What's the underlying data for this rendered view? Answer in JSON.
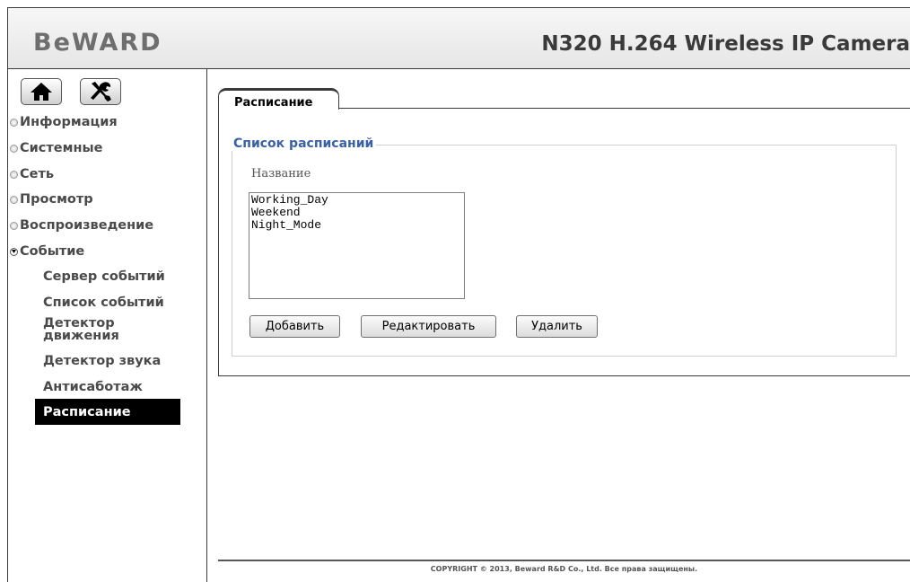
{
  "header": {
    "logo": "BeWARD",
    "title": "N320 H.264 Wireless IP Camera"
  },
  "sidebar": {
    "home_icon": "home-icon",
    "settings_icon": "tools-icon",
    "items": [
      {
        "label": "Информация",
        "state": "collapsed"
      },
      {
        "label": "Системные",
        "state": "collapsed"
      },
      {
        "label": "Сеть",
        "state": "collapsed"
      },
      {
        "label": "Просмотр",
        "state": "collapsed"
      },
      {
        "label": "Воспроизведение",
        "state": "collapsed"
      },
      {
        "label": "Событие",
        "state": "expanded"
      }
    ],
    "subitems": [
      {
        "label": "Сервер событий"
      },
      {
        "label": "Список событий"
      },
      {
        "label": "Детектор движения"
      },
      {
        "label": "Детектор звука"
      },
      {
        "label": "Антисаботаж"
      },
      {
        "label": "Расписание",
        "active": true
      }
    ]
  },
  "main": {
    "tab_label": "Расписание",
    "legend": "Список расписаний",
    "column_header": "Название",
    "schedules": [
      "Working_Day",
      "Weekend",
      "Night_Mode"
    ],
    "buttons": {
      "add": "Добавить",
      "edit": "Редактировать",
      "delete": "Удалить"
    }
  },
  "footer": {
    "copyright": "COPYRIGHT © 2013, Beward R&D Co., Ltd. Все права защищены."
  },
  "colors": {
    "legend": "#3a61a5",
    "active_bg": "#000000",
    "border": "#3a3a3a"
  }
}
